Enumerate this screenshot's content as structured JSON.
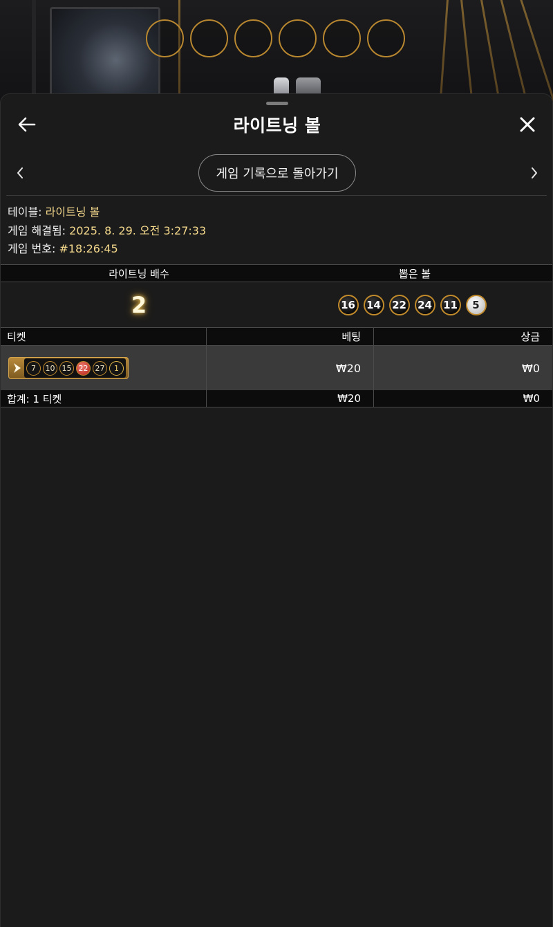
{
  "sheet": {
    "title": "라이트닝 볼",
    "back_icon": "arrow-left-icon",
    "close_icon": "close-icon"
  },
  "nav": {
    "history_button": "게임 기록으로 돌아가기",
    "prev_icon": "chevron-left-icon",
    "next_icon": "chevron-right-icon"
  },
  "info": {
    "table_label": "테이블:",
    "table_value": "라이트닝 볼",
    "resolved_label": "게임 해결됨:",
    "resolved_value": "2025. 8. 29. 오전 3:27:33",
    "game_no_label": "게임 번호:",
    "game_no_value": "#18:26:45"
  },
  "result": {
    "multiplier_header": "라이트닝 배수",
    "drawn_header": "뽑은 볼",
    "multiplier": "2",
    "drawn_balls": [
      "16",
      "14",
      "22",
      "24",
      "11",
      "5"
    ]
  },
  "tickets": {
    "headers": {
      "ticket": "티켓",
      "bet": "베팅",
      "payout": "상금"
    },
    "rows": [
      {
        "numbers": [
          "7",
          "10",
          "15",
          "22",
          "27",
          "1"
        ],
        "bet": "₩20",
        "payout": "₩0"
      }
    ],
    "total": {
      "label": "합계: 1 티켓",
      "bet": "₩20",
      "payout": "₩0"
    }
  },
  "colors": {
    "accent_gold": "#c18a2b",
    "value_text": "#f5d98c",
    "sheet_bg": "#1b1b1b"
  }
}
